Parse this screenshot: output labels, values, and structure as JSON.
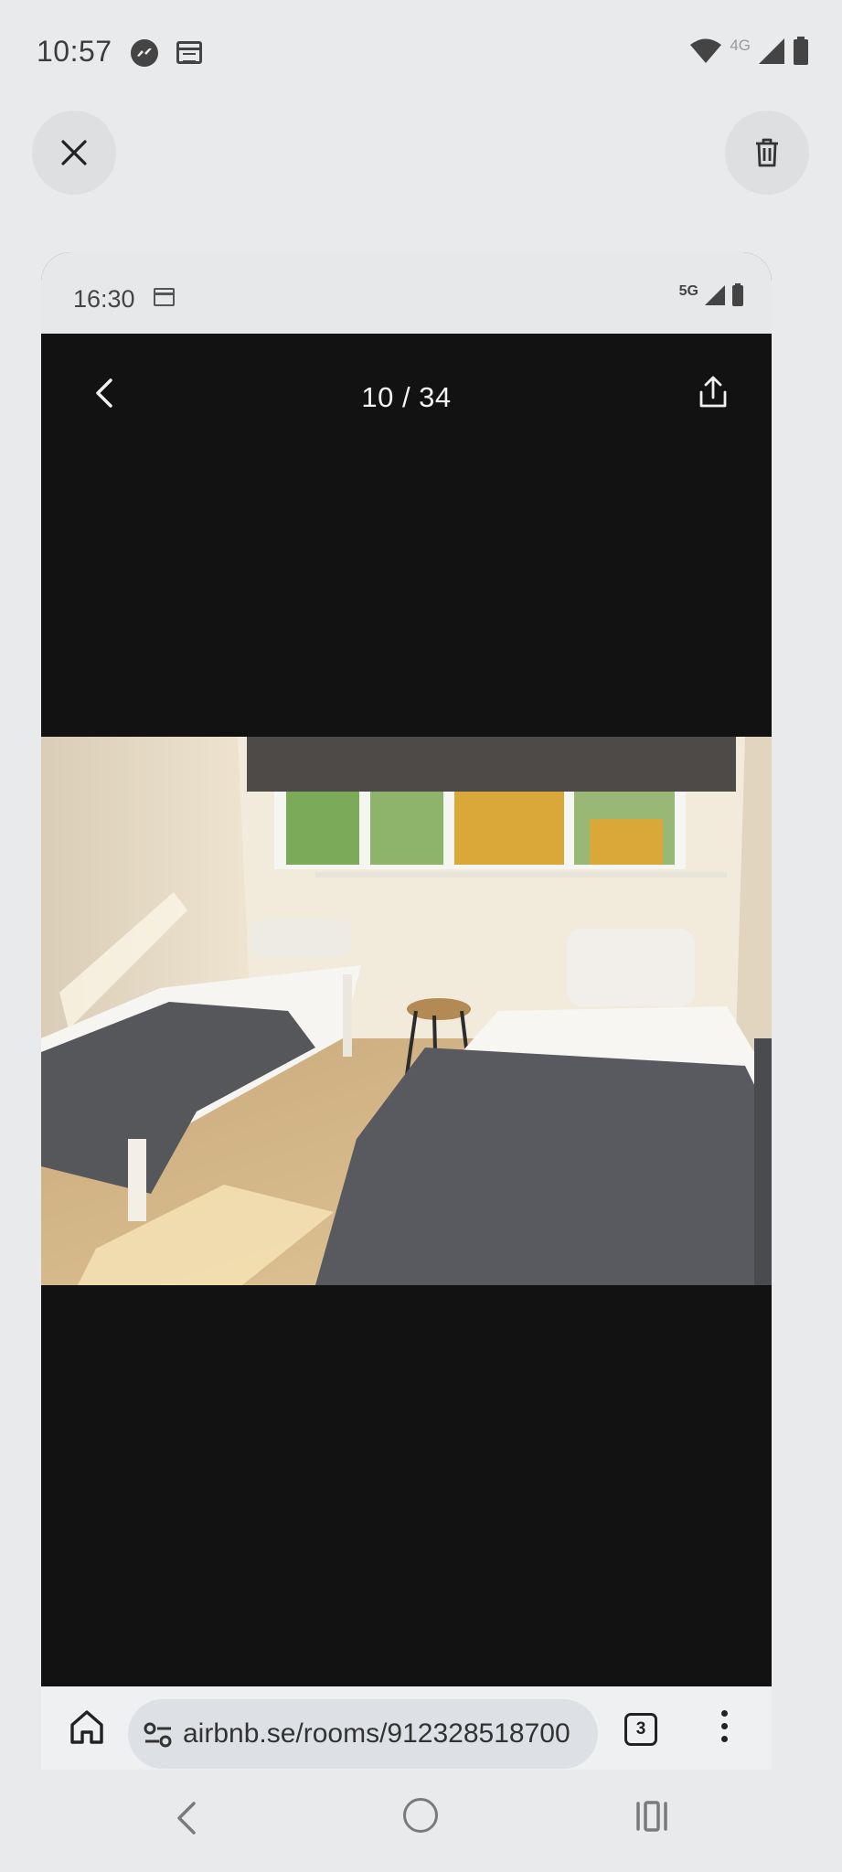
{
  "outer_status": {
    "time": "10:57",
    "network": "4G",
    "icons": [
      "messenger-icon",
      "calendar-icon",
      "wifi-icon",
      "signal-icon",
      "battery-icon"
    ]
  },
  "actions": {
    "close_icon": "close-icon",
    "delete_icon": "trash-icon"
  },
  "inner_status": {
    "time": "16:30",
    "network": "5G",
    "icons": [
      "calendar-icon",
      "signal-icon",
      "battery-icon"
    ]
  },
  "gallery": {
    "counter": "10 / 34",
    "icons": [
      "back-chevron-icon",
      "share-icon"
    ]
  },
  "photo": {
    "subject": "bedroom-photo"
  },
  "browser": {
    "url": "airbnb.se/rooms/912328518700",
    "tab_count": "3",
    "icons": [
      "home-icon",
      "site-settings-icon",
      "more-vert-icon"
    ]
  },
  "system_nav": {
    "icons": [
      "nav-back-icon",
      "nav-home-icon",
      "nav-recents-icon"
    ]
  },
  "colors": {
    "page_bg": "#e9eaec",
    "viewer_bg": "#121212",
    "pill_bg": "#dde0e4"
  }
}
